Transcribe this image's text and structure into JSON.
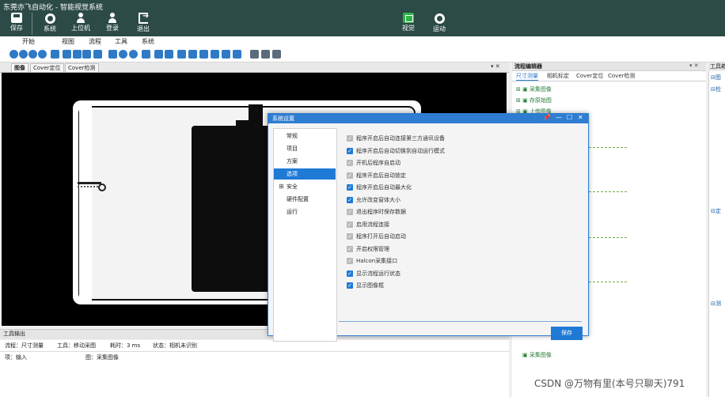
{
  "app_title": "东莞亦飞自动化 - 智能视觉系统",
  "ribbon": {
    "save": "保存",
    "system": "系统",
    "host": "上位机",
    "login": "登录",
    "exit": "退出",
    "vision": "视觉",
    "motion": "运动"
  },
  "menu": [
    "开始",
    "视图",
    "流程",
    "工具",
    "系统"
  ],
  "image_tabs": [
    "图像",
    "Cover定位",
    "Cover检测"
  ],
  "pane_controls": "▾ ✕",
  "output": {
    "title": "工具输出",
    "flow_label": "流程：尺寸测量",
    "tool_label": "工具：移动采图",
    "time_label": "耗时：3 ms",
    "status_label": "状态：相机未识别",
    "input_label": "项：输入",
    "image_label": "图：采集图像"
  },
  "flow_editor": {
    "title": "流程编辑器",
    "controls": "▾ ✕",
    "tabs": [
      "尺寸测量",
      "相机标定",
      "Cover定位",
      "Cover检测"
    ],
    "tree_items": [
      "采集图像",
      "存原始图",
      "上传图像"
    ],
    "bottom_item": "采集图像"
  },
  "toolbox": {
    "title": "工具箱",
    "items": [
      "图",
      "检",
      "定",
      "测"
    ]
  },
  "dialog": {
    "title": "系统设置",
    "controls": [
      "📌",
      "—",
      "☐",
      "✕"
    ],
    "nav": [
      {
        "label": "常规",
        "expander": ""
      },
      {
        "label": "项目",
        "expander": ""
      },
      {
        "label": "方案",
        "expander": ""
      },
      {
        "label": "选项",
        "expander": ""
      },
      {
        "label": "安全",
        "expander": "⊞"
      },
      {
        "label": "硬件配置",
        "expander": ""
      },
      {
        "label": "运行",
        "expander": ""
      }
    ],
    "active_nav_index": 3,
    "options": [
      {
        "label": "程序开启后自动连接第三方通讯设备",
        "checked": false
      },
      {
        "label": "程序开启后自动切换到自动运行模式",
        "checked": true
      },
      {
        "label": "开机后程序自启动",
        "checked": false
      },
      {
        "label": "程序开启后自动锁定",
        "checked": false
      },
      {
        "label": "程序开启后自动最大化",
        "checked": true
      },
      {
        "label": "允许改变窗体大小",
        "checked": true
      },
      {
        "label": "退出程序时保存数据",
        "checked": false
      },
      {
        "label": "启用流程连接",
        "checked": false
      },
      {
        "label": "程序打开后自动启动",
        "checked": false
      },
      {
        "label": "开启权限管理",
        "checked": false
      },
      {
        "label": "Halcon采集接口",
        "checked": false
      },
      {
        "label": "显示流程运行状态",
        "checked": true
      },
      {
        "label": "显示图像框",
        "checked": true
      }
    ],
    "save": "保存"
  },
  "watermark": "CSDN @万物有里(本号只聊天)791",
  "colors": {
    "titlebar": "#2c4a46",
    "accent": "#1f7ad6",
    "vision_icon": "#2fb24a"
  }
}
